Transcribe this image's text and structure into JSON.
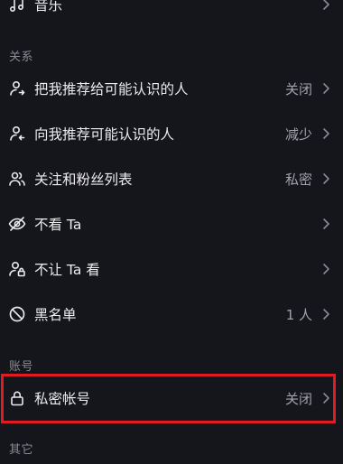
{
  "top_item": {
    "label": "音乐",
    "icon": "music-note-icon"
  },
  "sections": {
    "relations": {
      "header": "关系",
      "items": [
        {
          "label": "把我推荐给可能认识的人",
          "value": "关闭",
          "icon": "user-share-icon"
        },
        {
          "label": "向我推荐可能认识的人",
          "value": "减少",
          "icon": "user-recommend-icon"
        },
        {
          "label": "关注和粉丝列表",
          "value": "私密",
          "icon": "users-icon"
        },
        {
          "label": "不看 Ta",
          "value": "",
          "icon": "eye-off-icon"
        },
        {
          "label": "不让 Ta 看",
          "value": "",
          "icon": "user-lock-icon"
        },
        {
          "label": "黑名单",
          "value": "1 人",
          "icon": "block-icon"
        }
      ]
    },
    "account": {
      "header": "账号",
      "items": [
        {
          "label": "私密帐号",
          "value": "关闭",
          "icon": "lock-icon"
        }
      ]
    },
    "other": {
      "header": "其它"
    }
  },
  "colors": {
    "background": "#15151c",
    "text_primary": "#ececee",
    "text_secondary": "#a2a2aa",
    "section_header": "#8a8a92",
    "highlight": "#e01b24"
  }
}
